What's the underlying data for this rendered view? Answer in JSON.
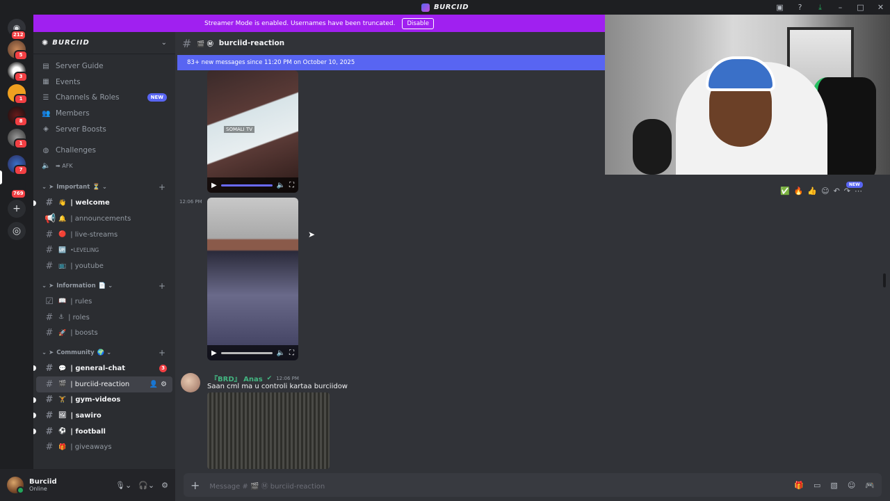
{
  "titlebar": {
    "app_title": "BURCIID"
  },
  "banner": {
    "text": "Streamer Mode is enabled. Usernames have been truncated.",
    "disable": "Disable"
  },
  "rail": {
    "badges": [
      "212",
      "5",
      "3",
      "1",
      "8",
      "1",
      "7",
      "769"
    ]
  },
  "sidebar": {
    "server_name": "BURCIID",
    "nav": [
      {
        "label": "Server Guide",
        "icon": "guide-icon"
      },
      {
        "label": "Events",
        "icon": "calendar-icon"
      },
      {
        "label": "Channels & Roles",
        "icon": "list-icon",
        "badge": "NEW"
      },
      {
        "label": "Members",
        "icon": "members-icon"
      },
      {
        "label": "Server Boosts",
        "icon": "boost-icon"
      }
    ],
    "challenges": "Challenges",
    "afk": "➡ AFK",
    "categories": {
      "important": "Important",
      "information": "Information",
      "community": "Community"
    },
    "channels_important": [
      {
        "emoji": "👋",
        "name": "| welcome",
        "unread": true
      },
      {
        "emoji": "🔔",
        "name": "| announcements",
        "unread": false
      },
      {
        "emoji": "🔴",
        "name": "| live-streams",
        "unread": false
      },
      {
        "emoji": "🆙",
        "name": "•LEVELING",
        "unread": false
      },
      {
        "emoji": "📺",
        "name": "| youtube",
        "unread": false
      }
    ],
    "channels_information": [
      {
        "emoji": "📖",
        "name": "| rules"
      },
      {
        "emoji": "⚓",
        "name": "| roles"
      },
      {
        "emoji": "🚀",
        "name": "| boosts"
      }
    ],
    "channels_community": [
      {
        "emoji": "💬",
        "name": "| general-chat",
        "unread": true,
        "mention": "3"
      },
      {
        "emoji": "🎬",
        "name": "| burciid-reaction",
        "active": true
      },
      {
        "emoji": "🏋",
        "name": "| gym-videos",
        "unread": true
      },
      {
        "emoji": "🖼",
        "name": "| sawiro",
        "unread": true
      },
      {
        "emoji": "⚽",
        "name": "| football",
        "unread": true
      },
      {
        "emoji": "🎁",
        "name": "| giveaways",
        "unread": false
      }
    ]
  },
  "user": {
    "name": "Burciid",
    "status": "Online"
  },
  "chat": {
    "channel": "burciid-reaction",
    "new_messages": "83+ new messages since 11:20 PM on October 10, 2025",
    "video_watermark": "SOMALI TV",
    "video_time": "12:06 PM",
    "new_tag": "NEW",
    "message": {
      "author": "『BRD』 Anas",
      "timestamp": "12:06 PM",
      "text": "Saan cml ma u controli kartaa burciidow"
    }
  },
  "composer": {
    "placeholder": "Message # 🎬 Ⓜ burciid-reaction"
  }
}
